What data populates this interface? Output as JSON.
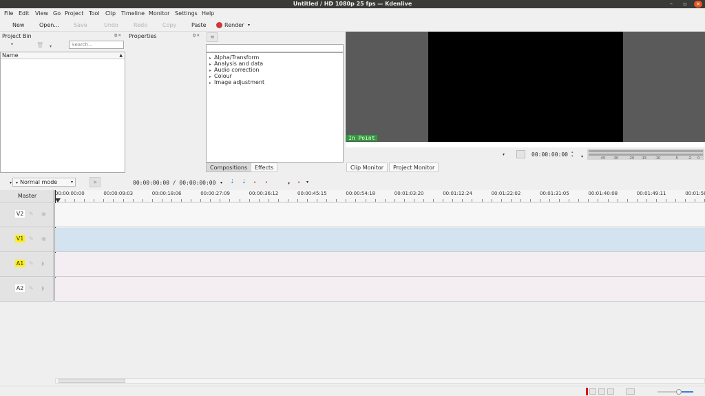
{
  "window": {
    "title": "Untitled / HD 1080p 25 fps — Kdenlive",
    "minimize": "–",
    "maximize": "▫",
    "close": "×"
  },
  "menu": [
    "File",
    "Edit",
    "View",
    "Go",
    "Project",
    "Tool",
    "Clip",
    "Timeline",
    "Monitor",
    "Settings",
    "Help"
  ],
  "toolbar": {
    "new": "New",
    "open": "Open...",
    "save": "Save",
    "undo": "Undo",
    "redo": "Redo",
    "copy": "Copy",
    "paste": "Paste",
    "render": "Render",
    "render_color": "#d0383d"
  },
  "project_bin": {
    "title": "Project Bin",
    "search_placeholder": "Search...",
    "column_name": "Name"
  },
  "properties": {
    "title": "Properties"
  },
  "effects": {
    "categories": [
      "Alpha/Transform",
      "Analysis and data",
      "Audio correction",
      "Colour",
      "Image adjustment"
    ],
    "tabs": [
      "Compositions",
      "Effects"
    ]
  },
  "monitor": {
    "in_point": "In Point",
    "timecode": "00:00:00:00",
    "tabs": [
      "Clip Monitor",
      "Project Monitor"
    ],
    "meter_scale": [
      "-45",
      "-30",
      "-20",
      "-15",
      "-10",
      "-5",
      "-2",
      "0"
    ]
  },
  "timeline": {
    "mode": "Normal mode",
    "position": "00:00:00:00 / 00:00:00:00",
    "master": "Master",
    "tracks": [
      {
        "name": "V2",
        "highlighted": false,
        "lane_color": "#f7f7f7"
      },
      {
        "name": "V1",
        "highlighted": true,
        "lane_color": "#d3e3ef"
      },
      {
        "name": "A1",
        "highlighted": true,
        "lane_color": "#f4eef2"
      },
      {
        "name": "A2",
        "highlighted": false,
        "lane_color": "#f4eef2"
      }
    ],
    "ruler_labels": [
      "00:00:00:00",
      "00:00:09:03",
      "00:00:18:06",
      "00:00:27:09",
      "00:00:36:12",
      "00:00:45:15",
      "00:00:54:18",
      "00:01:03:20",
      "00:01:12:24",
      "00:01:22:02",
      "00:01:31:05",
      "00:01:40:08",
      "00:01:49:11",
      "00:01:58"
    ]
  }
}
